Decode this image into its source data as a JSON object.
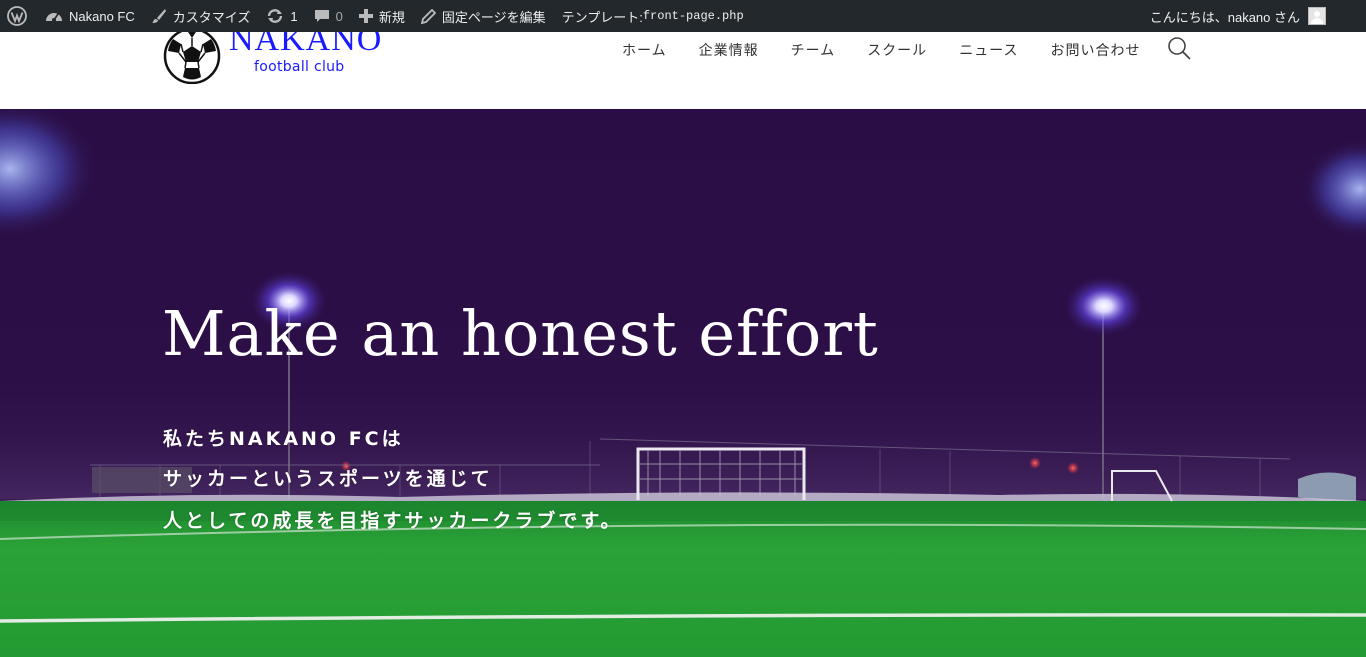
{
  "adminbar": {
    "wp_logo_icon": "wordpress-icon",
    "site_name": "Nakano FC",
    "customize": "カスタマイズ",
    "updates_count": "1",
    "comments_count": "0",
    "new_label": "新規",
    "edit_page": "固定ページを編集",
    "template_label": "テンプレート:",
    "template_file": "front-page.php",
    "greeting": "こんにちは、nakano さん"
  },
  "header": {
    "logo_name": "NAKANO",
    "logo_sub": "football club",
    "nav": [
      "ホーム",
      "企業情報",
      "チーム",
      "スクール",
      "ニュース",
      "お問い合わせ"
    ],
    "search_icon": "search-icon"
  },
  "hero": {
    "title": "Make an honest effort",
    "lines": [
      "私たちNAKANO FCは",
      "サッカーというスポーツを通じて",
      "人としての成長を目指すサッカークラブです。"
    ]
  },
  "colors": {
    "adminbar_bg": "#23282d",
    "logo_blue": "#1a1aff",
    "hero_sky": "#2c0f46",
    "pitch_green": "#2fae3a"
  }
}
